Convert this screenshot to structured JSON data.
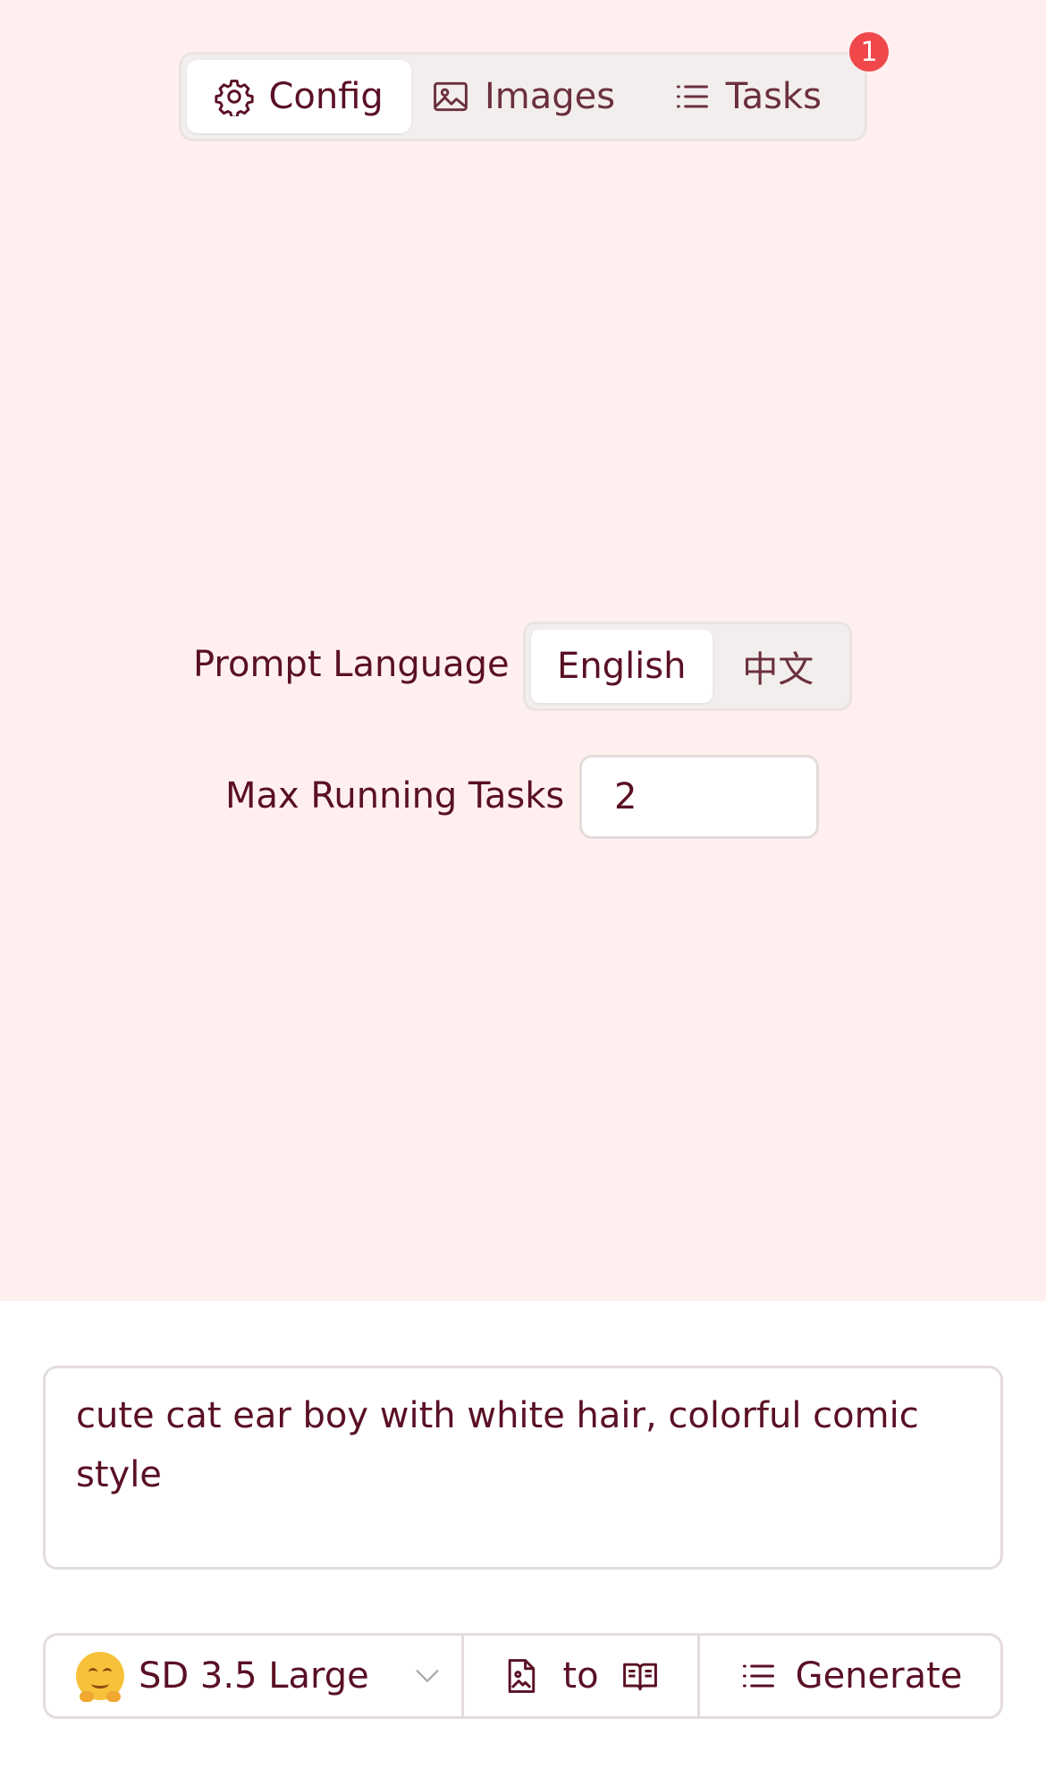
{
  "tabs": [
    {
      "label": "Config",
      "icon": "gear-icon",
      "active": true
    },
    {
      "label": "Images",
      "icon": "image-icon",
      "active": false
    },
    {
      "label": "Tasks",
      "icon": "list-icon",
      "active": false
    }
  ],
  "badge": {
    "count": "1",
    "color": "#f0474b"
  },
  "config": {
    "prompt_language_label": "Prompt Language",
    "languages": [
      "English",
      "中文"
    ],
    "selected_language": "English",
    "max_running_tasks_label": "Max Running Tasks",
    "max_running_tasks_value": "2"
  },
  "prompt": {
    "text": "cute cat ear boy with white hair, colorful comic style"
  },
  "toolbar": {
    "model_label": "SD 3.5 Large",
    "model_icon": "hugging-face-emoji",
    "mode_label": "to",
    "mode_from_icon": "image-file-icon",
    "mode_to_icon": "book-icon",
    "generate_label": "Generate",
    "generate_icon": "list-icon"
  },
  "colors": {
    "background_top": "#fff0ef",
    "text": "#5a1024",
    "badge": "#f0474b"
  }
}
